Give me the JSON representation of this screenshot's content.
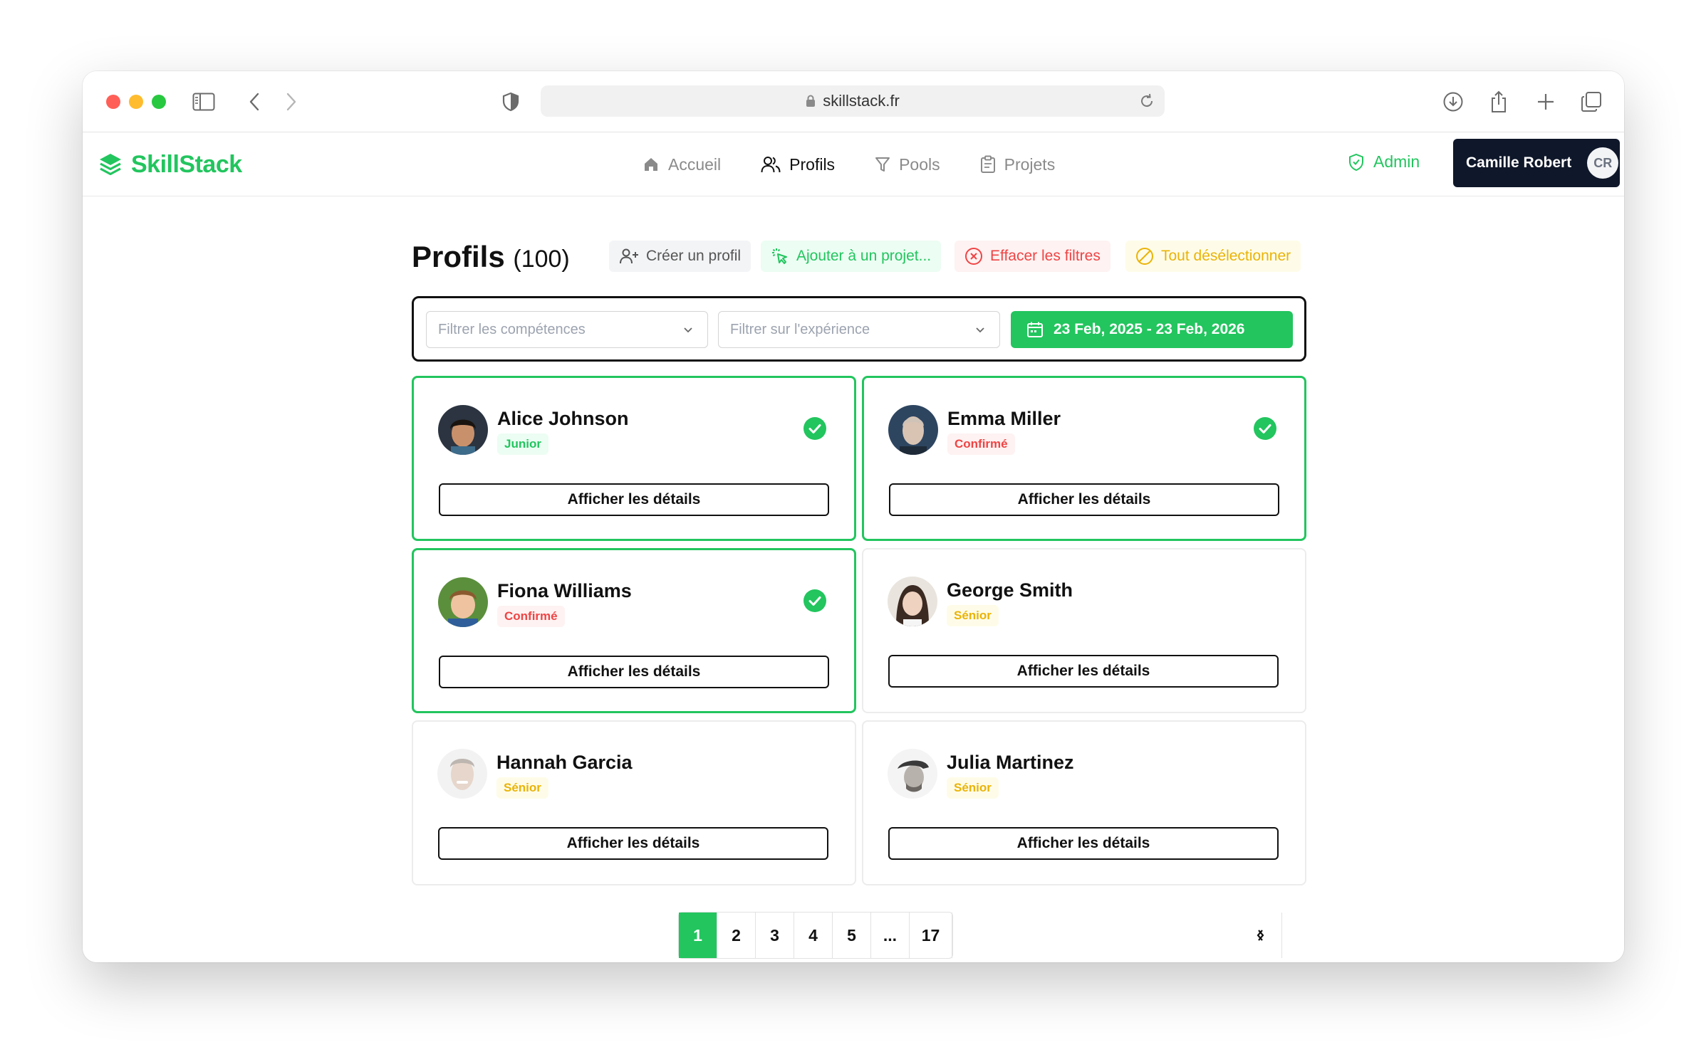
{
  "browser": {
    "url": "skillstack.fr"
  },
  "app": {
    "brand": "SkillStack",
    "nav": [
      {
        "label": "Accueil",
        "icon": "home-icon",
        "active": false
      },
      {
        "label": "Profils",
        "icon": "users-icon",
        "active": true
      },
      {
        "label": "Pools",
        "icon": "filter-icon",
        "active": false
      },
      {
        "label": "Projets",
        "icon": "clipboard-icon",
        "active": false
      }
    ],
    "admin_label": "Admin",
    "user": {
      "name": "Camille Robert",
      "initials": "CR"
    }
  },
  "page": {
    "title": "Profils",
    "count": "(100)",
    "actions": {
      "create": "Créer un profil",
      "add_project": "Ajouter à un projet...",
      "clear_filters": "Effacer les filtres",
      "deselect_all": "Tout désélectionner"
    },
    "filters": {
      "skills_placeholder": "Filtrer les compétences",
      "experience_placeholder": "Filtrer sur l'expérience",
      "date_range": "23 Feb, 2025 - 23 Feb, 2026"
    },
    "details_label": "Afficher les détails",
    "profiles": [
      {
        "name": "Alice Johnson",
        "level": "Junior",
        "selected": true
      },
      {
        "name": "Emma Miller",
        "level": "Confirmé",
        "selected": true
      },
      {
        "name": "Fiona Williams",
        "level": "Confirmé",
        "selected": true
      },
      {
        "name": "George Smith",
        "level": "Sénior",
        "selected": false
      },
      {
        "name": "Hannah Garcia",
        "level": "Sénior",
        "selected": false
      },
      {
        "name": "Julia Martinez",
        "level": "Sénior",
        "selected": false
      }
    ],
    "pagination": {
      "pages": [
        "1",
        "2",
        "3",
        "4",
        "5",
        "...",
        "17"
      ],
      "current": "1"
    }
  },
  "colors": {
    "accent": "#22c55e",
    "danger": "#ef4444",
    "warning": "#eab308",
    "dark": "#0f172a"
  }
}
